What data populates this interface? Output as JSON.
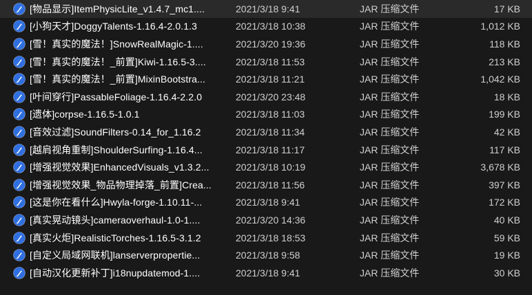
{
  "files": [
    {
      "name": "[物品显示]ItemPhysicLite_v1.4.7_mc1....",
      "date": "2021/3/18 9:41",
      "type": "JAR 压缩文件",
      "size": "17 KB"
    },
    {
      "name": "[小狗天才]DoggyTalents-1.16.4-2.0.1.3",
      "date": "2021/3/18 10:38",
      "type": "JAR 压缩文件",
      "size": "1,012 KB"
    },
    {
      "name": "[雪！真实的魔法！]SnowRealMagic-1....",
      "date": "2021/3/20 19:36",
      "type": "JAR 压缩文件",
      "size": "118 KB"
    },
    {
      "name": "[雪！真实的魔法！_前置]Kiwi-1.16.5-3....",
      "date": "2021/3/18 11:53",
      "type": "JAR 压缩文件",
      "size": "213 KB"
    },
    {
      "name": "[雪！真实的魔法！_前置]MixinBootstra...",
      "date": "2021/3/18 11:21",
      "type": "JAR 压缩文件",
      "size": "1,042 KB"
    },
    {
      "name": "[叶间穿行]PassableFoliage-1.16.4-2.2.0",
      "date": "2021/3/20 23:48",
      "type": "JAR 压缩文件",
      "size": "18 KB"
    },
    {
      "name": "[遗体]corpse-1.16.5-1.0.1",
      "date": "2021/3/18 11:03",
      "type": "JAR 压缩文件",
      "size": "199 KB"
    },
    {
      "name": "[音效过滤]SoundFilters-0.14_for_1.16.2",
      "date": "2021/3/18 11:34",
      "type": "JAR 压缩文件",
      "size": "42 KB"
    },
    {
      "name": "[越肩视角重制]ShoulderSurfing-1.16.4...",
      "date": "2021/3/18 11:17",
      "type": "JAR 压缩文件",
      "size": "117 KB"
    },
    {
      "name": "[增强视觉效果]EnhancedVisuals_v1.3.2...",
      "date": "2021/3/18 10:19",
      "type": "JAR 压缩文件",
      "size": "3,678 KB"
    },
    {
      "name": "[增强视觉效果_物品物理掉落_前置]Crea...",
      "date": "2021/3/18 11:56",
      "type": "JAR 压缩文件",
      "size": "397 KB"
    },
    {
      "name": "[这是你在看什么]Hwyla-forge-1.10.11-...",
      "date": "2021/3/18 9:41",
      "type": "JAR 压缩文件",
      "size": "172 KB"
    },
    {
      "name": "[真实晃动镜头]cameraoverhaul-1.0-1....",
      "date": "2021/3/20 14:36",
      "type": "JAR 压缩文件",
      "size": "40 KB"
    },
    {
      "name": "[真实火炬]RealisticTorches-1.16.5-3.1.2",
      "date": "2021/3/18 18:53",
      "type": "JAR 压缩文件",
      "size": "59 KB"
    },
    {
      "name": "[自定义局域网联机]lanserverpropertie...",
      "date": "2021/3/18 9:58",
      "type": "JAR 压缩文件",
      "size": "19 KB"
    },
    {
      "name": "[自动汉化更新补丁]i18nupdatemod-1....",
      "date": "2021/3/18 9:41",
      "type": "JAR 压缩文件",
      "size": "30 KB"
    }
  ],
  "icon": "jar-file-icon",
  "colors": {
    "background": "#191919",
    "icon_blue": "#2f6fe0",
    "text": "#ffffff"
  }
}
